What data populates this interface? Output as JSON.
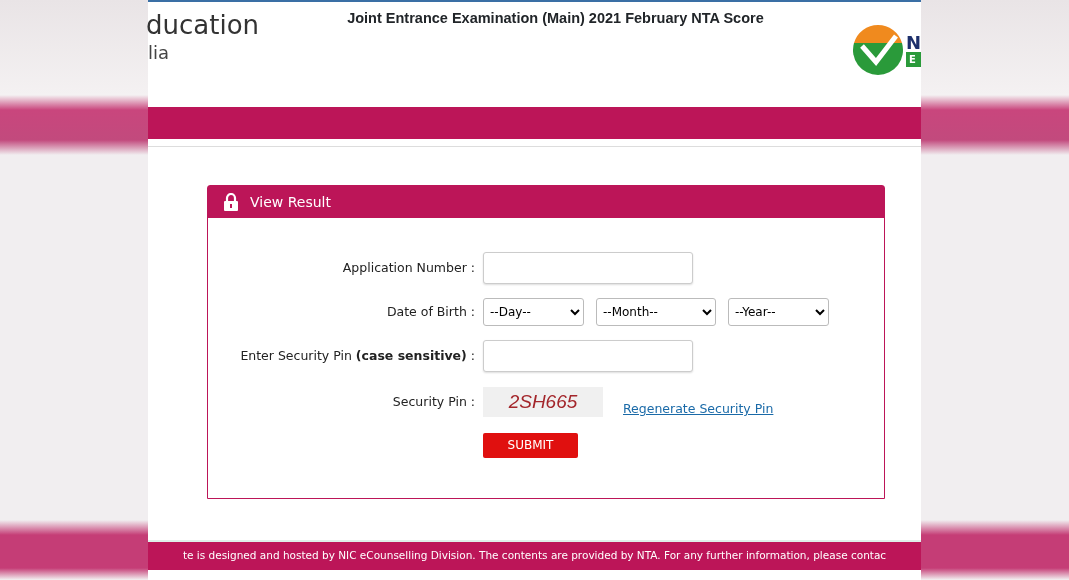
{
  "header": {
    "title": "Joint Entrance Examination (Main) 2021 February NTA Score",
    "brand_lines": [
      "ducation",
      "lia"
    ],
    "logo_letters": [
      "N",
      "E"
    ]
  },
  "card": {
    "title": "View Result",
    "fields": [
      {
        "kind": "text",
        "label": "Application Number :"
      },
      {
        "kind": "selects",
        "label": "Date of Birth :",
        "values": [
          "--Day--",
          "--Month--",
          "--Year--"
        ]
      },
      {
        "kind": "text",
        "label": "Enter Security Pin **(case sensitive)** :"
      },
      {
        "kind": "captcha",
        "label": "Security Pin :",
        "code": "2SH665",
        "link": "Regenerate Security Pin"
      }
    ],
    "submit": "SUBMIT"
  },
  "footer": {
    "text": "te is designed and hosted by NIC eCounselling Division. The contents are provided by NTA. For any further information, please contac"
  }
}
